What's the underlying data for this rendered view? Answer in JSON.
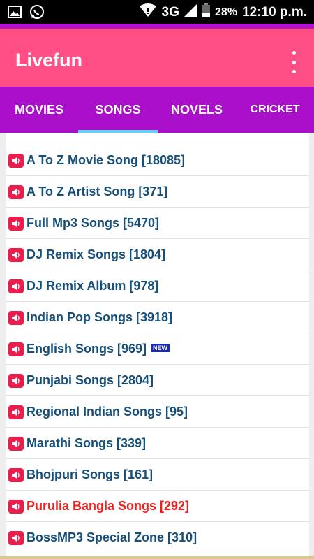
{
  "status_bar": {
    "network": "3G",
    "battery": "28%",
    "time": "12:10 p.m.",
    "icons": [
      "gallery-icon",
      "whatsapp-icon",
      "wifi-icon",
      "signal-icon",
      "battery-icon"
    ]
  },
  "app_bar": {
    "title": "Livefun",
    "menu_icon": "overflow-menu-icon"
  },
  "tabs": [
    {
      "label": "MOVIES",
      "selected": false
    },
    {
      "label": "SONGS",
      "selected": true
    },
    {
      "label": "NOVELS",
      "selected": false
    },
    {
      "label": "CRICKET",
      "selected": false
    }
  ],
  "list": {
    "items": [
      {
        "label": "A To Z Movie Song [18085]"
      },
      {
        "label": "A To Z Artist Song [371]"
      },
      {
        "label": "Full Mp3 Songs [5470]"
      },
      {
        "label": "DJ Remix Songs [1804]"
      },
      {
        "label": "DJ Remix Album [978]"
      },
      {
        "label": "Indian Pop Songs [3918]"
      },
      {
        "label": "English Songs [969]",
        "badge": "NEW"
      },
      {
        "label": "Punjabi Songs [2804]"
      },
      {
        "label": "Regional Indian Songs [95]"
      },
      {
        "label": "Marathi Songs [339]"
      },
      {
        "label": "Bhojpuri Songs [161]"
      },
      {
        "label": "Purulia Bangla Songs [292]",
        "highlight_color": "#ef2020"
      },
      {
        "label": "BossMP3 Special Zone [310]"
      }
    ]
  },
  "colors": {
    "app_bar": "#ff4f84",
    "tab_bar": "#aa10c9",
    "tab_indicator": "#5ed4f2",
    "item_text": "#16507a",
    "speaker_icon": "#e91e4c"
  }
}
